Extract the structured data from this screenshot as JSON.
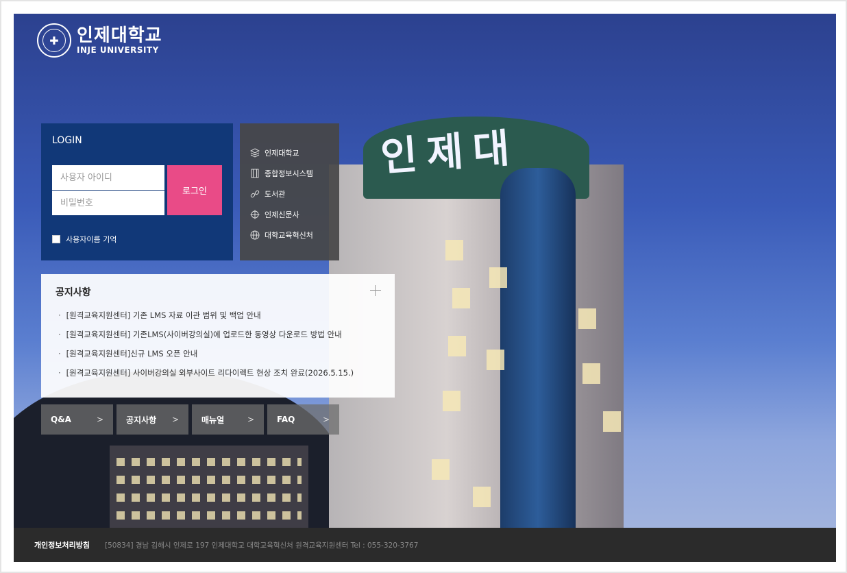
{
  "logo": {
    "seal_glyph": "✚",
    "name_ko": "인제대학교",
    "name_en": "INJE UNIVERSITY"
  },
  "background": {
    "sign": "인제대"
  },
  "login": {
    "title": "LOGIN",
    "username_placeholder": "사용자 아이디",
    "password_placeholder": "비밀번호",
    "submit_label": "로그인",
    "remember_label": "사용자이름 기억",
    "accent_color": "#e94b87",
    "panel_color": "#113878"
  },
  "links": [
    {
      "label": "인제대학교",
      "icon": "layers-icon"
    },
    {
      "label": "종합정보시스템",
      "icon": "film-icon"
    },
    {
      "label": "도서관",
      "icon": "link-icon"
    },
    {
      "label": "인제신문사",
      "icon": "crosshair-icon"
    },
    {
      "label": "대학교육혁신처",
      "icon": "globe-icon"
    }
  ],
  "notice": {
    "title": "공지사항",
    "items": [
      "[원격교육지원센터] 기존 LMS 자료 이관 범위 및 백업 안내",
      "[원격교육지원센터] 기존LMS(사이버강의실)에 업로드한 동영상 다운로드 방법 안내",
      "[원격교육지원센터]신규 LMS 오픈 안내",
      "[원격교육지원센터] 사이버강의실 외부사이트 리다이렉트 현상 조치 완료(2026.5.15.)"
    ]
  },
  "quick_buttons": [
    "Q&A",
    "공지사항",
    "매뉴얼",
    "FAQ"
  ],
  "footer": {
    "privacy": "개인정보처리방침",
    "address": "[50834] 경남 김해시 인제로 197 인제대학교 대학교육혁신처 원격교육지원센터   Tel : 055-320-3767"
  }
}
